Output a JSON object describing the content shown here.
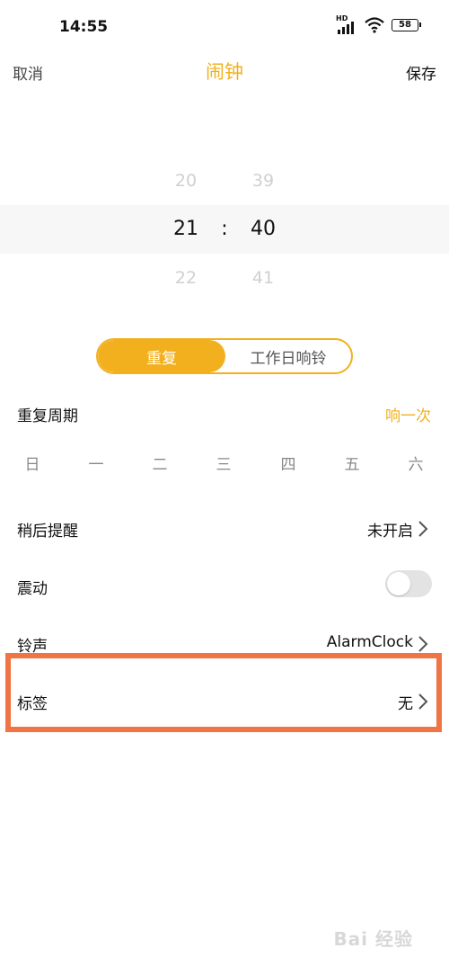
{
  "status_bar": {
    "time": "14:55",
    "network_label": "HD",
    "battery_level": "58",
    "icons": [
      "signal-icon",
      "wifi-icon",
      "battery-icon"
    ]
  },
  "header": {
    "cancel_label": "取消",
    "title": "闹钟",
    "save_label": "保存"
  },
  "time_picker": {
    "hours": [
      "20",
      "21",
      "22"
    ],
    "separator": ":",
    "minutes": [
      "39",
      "40",
      "41"
    ]
  },
  "repeat_toggle": {
    "options": [
      "重复",
      "工作日响铃"
    ],
    "selected": "重复"
  },
  "repeat_cycle": {
    "label": "重复周期",
    "value": "响一次"
  },
  "weekdays": [
    "日",
    "一",
    "二",
    "三",
    "四",
    "五",
    "六"
  ],
  "snooze": {
    "label": "稍后提醒",
    "value": "未开启"
  },
  "vibrate": {
    "label": "震动",
    "enabled": false
  },
  "ringtone": {
    "label": "铃声",
    "value": "AlarmClock"
  },
  "tag": {
    "label": "标签",
    "value": "无"
  },
  "watermark": "Bai 经验",
  "colors": {
    "accent": "#f2b01e",
    "highlight_border": "#f07444",
    "toggle_off": "#e3e3e3"
  }
}
